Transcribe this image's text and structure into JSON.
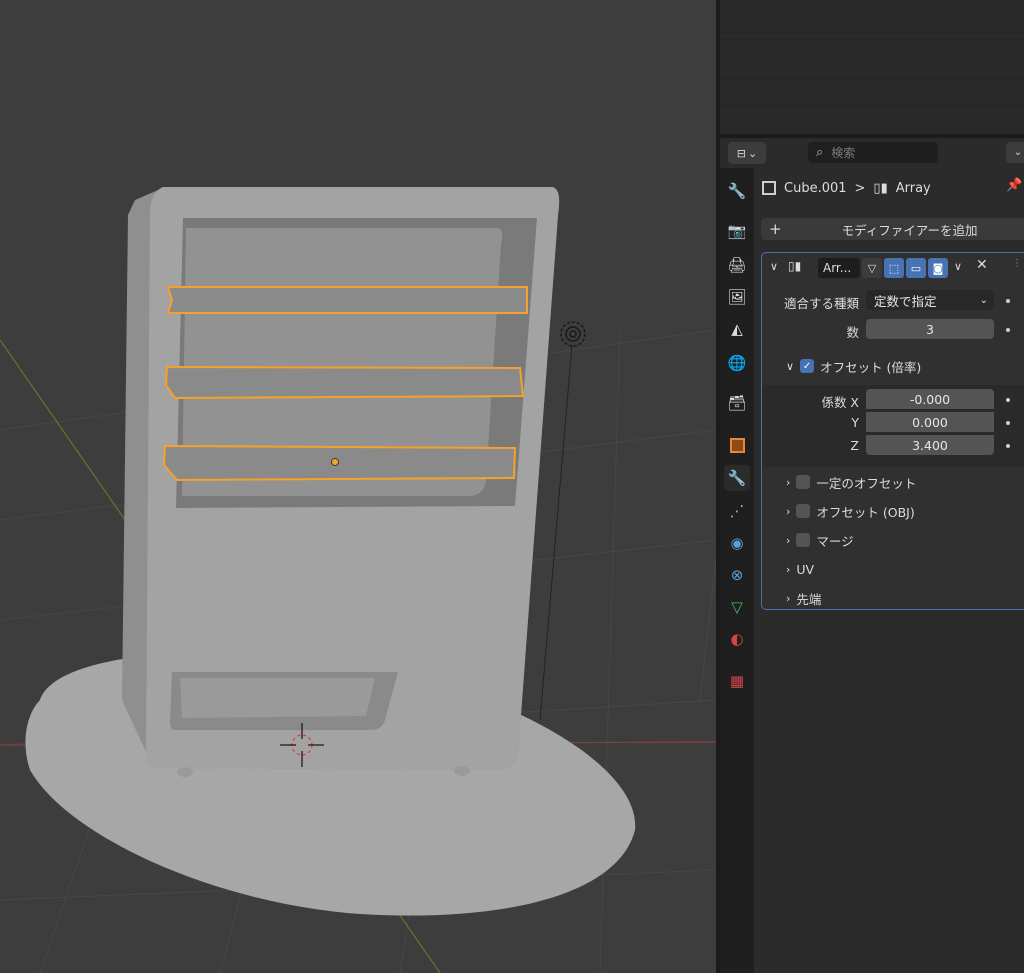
{
  "properties": {
    "search_placeholder": "検索",
    "breadcrumb": {
      "object": "Cube.001",
      "separator": ">",
      "modifier": "Array"
    },
    "add_modifier_label": "モディファイアーを追加",
    "modifier": {
      "name": "Arr...",
      "fit_type_label": "適合する種類",
      "fit_type_value": "定数で指定",
      "count_label": "数",
      "count_value": "3",
      "relative_offset_label": "オフセット (倍率)",
      "relative_offset_enabled": true,
      "factor_x_label": "係数 X",
      "factor_x_value": "-0.000",
      "factor_y_label": "Y",
      "factor_y_value": "0.000",
      "factor_z_label": "Z",
      "factor_z_value": "3.400",
      "constant_offset_label": "一定のオフセット",
      "object_offset_label": "オフセット (OBJ)",
      "merge_label": "マージ",
      "uv_label": "UV",
      "caps_label": "先端"
    }
  },
  "tabs": [
    "tool-icon",
    "render-icon",
    "output-icon",
    "view-layer-icon",
    "scene-icon",
    "world-icon",
    "collection-icon",
    "object-icon",
    "modifier-icon",
    "particles-icon",
    "physics-icon",
    "constraints-icon",
    "data-icon",
    "material-icon",
    "texture-icon"
  ],
  "active_tab": "modifier-icon",
  "colors": {
    "accent": "#4772b3",
    "selection": "#f5a623",
    "tab_modifier": "#5a9fd6"
  }
}
